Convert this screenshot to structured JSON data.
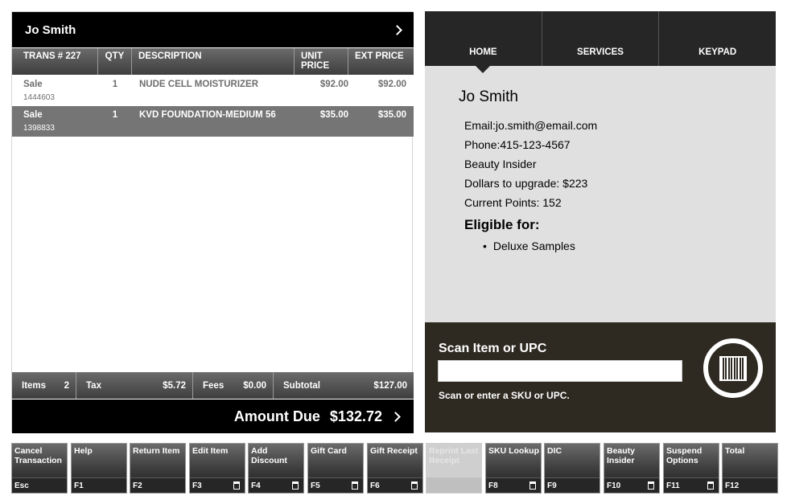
{
  "customer_bar": {
    "name": "Jo Smith"
  },
  "items_table": {
    "headers": {
      "trans": "TRANS # 227",
      "qty": "QTY",
      "description": "DESCRIPTION",
      "unit_price": "UNIT PRICE",
      "ext_price": "EXT PRICE"
    },
    "rows": [
      {
        "type": "Sale",
        "sku": "1444603",
        "qty": "1",
        "description": "NUDE CELL MOISTURIZER",
        "unit_price": "$92.00",
        "ext_price": "$92.00"
      },
      {
        "type": "Sale",
        "sku": "1398833",
        "qty": "1",
        "description": "KVD FOUNDATION-MEDIUM 56",
        "unit_price": "$35.00",
        "ext_price": "$35.00"
      }
    ]
  },
  "totals": {
    "items_label": "Items",
    "items_value": "2",
    "tax_label": "Tax",
    "tax_value": "$5.72",
    "fees_label": "Fees",
    "fees_value": "$0.00",
    "subtotal_label": "Subtotal",
    "subtotal_value": "$127.00"
  },
  "amount_due": {
    "label": "Amount Due",
    "value": "$132.72"
  },
  "tabs": [
    "HOME",
    "SERVICES",
    "KEYPAD"
  ],
  "profile": {
    "name": "Jo  Smith",
    "email": "Email:jo.smith@email.com",
    "phone": "Phone:415-123-4567",
    "tier": "Beauty Insider",
    "upgrade": "Dollars to upgrade: $223",
    "points": "Current Points: 152",
    "eligible_title": "Eligible for:",
    "eligible_items": [
      "Deluxe Samples"
    ]
  },
  "scan": {
    "title": "Scan Item or UPC",
    "input_value": "",
    "hint": "Scan or enter a SKU or UPC."
  },
  "function_keys": [
    {
      "label": "Cancel Transaction",
      "key": "Esc",
      "trash": false,
      "disabled": false
    },
    {
      "label": "Help",
      "key": "F1",
      "trash": false,
      "disabled": false
    },
    {
      "label": "Return Item",
      "key": "F2",
      "trash": false,
      "disabled": false
    },
    {
      "label": "Edit Item",
      "key": "F3",
      "trash": true,
      "disabled": false
    },
    {
      "label": "Add Discount",
      "key": "F4",
      "trash": true,
      "disabled": false
    },
    {
      "label": "Gift Card",
      "key": "F5",
      "trash": true,
      "disabled": false
    },
    {
      "label": "Gift Receipt",
      "key": "F6",
      "trash": true,
      "disabled": false
    },
    {
      "label": "Reprint Last Receipt",
      "key": "",
      "trash": false,
      "disabled": true
    },
    {
      "label": "SKU Lookup",
      "key": "F8",
      "trash": true,
      "disabled": false
    },
    {
      "label": "DIC",
      "key": "F9",
      "trash": false,
      "disabled": false
    },
    {
      "label": "Beauty Insider",
      "key": "F10",
      "trash": true,
      "disabled": false
    },
    {
      "label": "Suspend Options",
      "key": "F11",
      "trash": true,
      "disabled": false
    },
    {
      "label": "Total",
      "key": "F12",
      "trash": false,
      "disabled": false
    }
  ]
}
